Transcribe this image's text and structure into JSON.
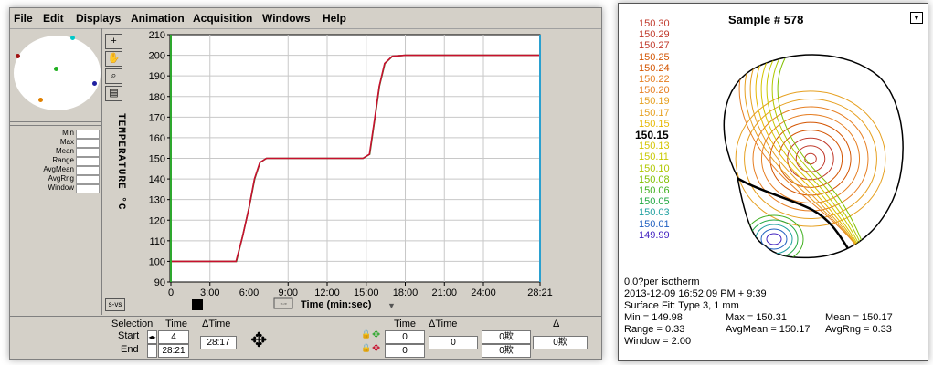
{
  "menu": [
    "File",
    "Edit",
    "Displays",
    "Animation",
    "Acquisition",
    "Windows",
    "Help"
  ],
  "stats_labels": [
    "Min",
    "Max",
    "Mean",
    "Range",
    "AvgMean",
    "AvgRng",
    "Window"
  ],
  "toolbar": {
    "sy_button": "s-vs"
  },
  "chart_data": {
    "type": "line",
    "ylabel": "TEMPERATURE °C",
    "xlabel": "Time (min:sec)",
    "ylim": [
      90,
      210
    ],
    "yticks": [
      "90",
      "100",
      "110",
      "120",
      "130",
      "140",
      "150",
      "160",
      "170",
      "180",
      "190",
      "200",
      "210"
    ],
    "xticks": [
      "0",
      "3:00",
      "6:00",
      "9:00",
      "12:00",
      "15:00",
      "18:00",
      "21:00",
      "24:00",
      "28:21"
    ],
    "xtick_values": [
      0,
      180,
      360,
      540,
      720,
      900,
      1080,
      1260,
      1440,
      1701
    ],
    "xlim": [
      0,
      1701
    ],
    "series": [
      {
        "color": "#c8102e",
        "points": [
          [
            0,
            100
          ],
          [
            300,
            100
          ],
          [
            330,
            112
          ],
          [
            360,
            126
          ],
          [
            385,
            140
          ],
          [
            410,
            148
          ],
          [
            440,
            150
          ],
          [
            700,
            150
          ],
          [
            885,
            150
          ],
          [
            915,
            152
          ],
          [
            940,
            170
          ],
          [
            960,
            185
          ],
          [
            985,
            196
          ],
          [
            1020,
            199.5
          ],
          [
            1080,
            200
          ],
          [
            1701,
            200
          ]
        ]
      },
      {
        "color": "#2e8b2e",
        "points": [
          [
            0,
            100
          ],
          [
            302,
            100
          ],
          [
            332,
            113
          ],
          [
            362,
            127
          ],
          [
            386,
            140
          ],
          [
            411,
            148
          ],
          [
            441,
            150
          ],
          [
            700,
            150
          ],
          [
            886,
            150
          ],
          [
            916,
            152
          ],
          [
            941,
            170
          ],
          [
            961,
            185
          ],
          [
            986,
            196
          ],
          [
            1021,
            199.5
          ],
          [
            1080,
            200
          ],
          [
            1701,
            200
          ]
        ]
      }
    ]
  },
  "bottom": {
    "selection_label": "Selection",
    "time_header": "Time",
    "dtime_header": "ΔTime",
    "start_label": "Start",
    "end_label": "End",
    "start_value": "4",
    "end_value": "28:21",
    "dtime_value": "28:17",
    "time_header2": "Time",
    "dtime_header2": "ΔTime",
    "delta_header": "Δ",
    "cursor1_time": "0",
    "cursor2_time": "0",
    "cursor_dtime": "0",
    "val1": "0欺",
    "val2": "0欺",
    "delta_val": "0欺"
  },
  "sample": {
    "title": "Sample # 578",
    "dropdown": "▼",
    "iso_labels": [
      {
        "text": "150.30",
        "color": "#c0392b"
      },
      {
        "text": "150.29",
        "color": "#c0392b"
      },
      {
        "text": "150.27",
        "color": "#c0392b"
      },
      {
        "text": "150.25",
        "color": "#d35400"
      },
      {
        "text": "150.24",
        "color": "#d35400"
      },
      {
        "text": "150.22",
        "color": "#e67e22"
      },
      {
        "text": "150.20",
        "color": "#e67e22"
      },
      {
        "text": "150.19",
        "color": "#e6a020"
      },
      {
        "text": "150.17",
        "color": "#e6a020"
      },
      {
        "text": "150.15",
        "color": "#e6b800"
      },
      {
        "text": "150.15",
        "color": "#000000"
      },
      {
        "text": "150.13",
        "color": "#d4c400"
      },
      {
        "text": "150.11",
        "color": "#c8c800"
      },
      {
        "text": "150.10",
        "color": "#b0c800"
      },
      {
        "text": "150.08",
        "color": "#80c000"
      },
      {
        "text": "150.06",
        "color": "#40b020"
      },
      {
        "text": "150.05",
        "color": "#20a840"
      },
      {
        "text": "150.03",
        "color": "#20a0a0"
      },
      {
        "text": "150.01",
        "color": "#2060c0"
      },
      {
        "text": "149.99",
        "color": "#4020c0"
      }
    ],
    "info_line1": "0.0?per isotherm",
    "info_line2": "2013-12-09 16:52:09 PM + 9:39",
    "info_line3": "Surface Fit: Type 3, 1 mm",
    "min": "Min = 149.98",
    "max": "Max = 150.31",
    "mean": "Mean = 150.17",
    "range": "Range = 0.33",
    "avgmean": "AvgMean = 150.17",
    "avgrng": "AvgRng = 0.33",
    "window": "Window = 2.00"
  }
}
